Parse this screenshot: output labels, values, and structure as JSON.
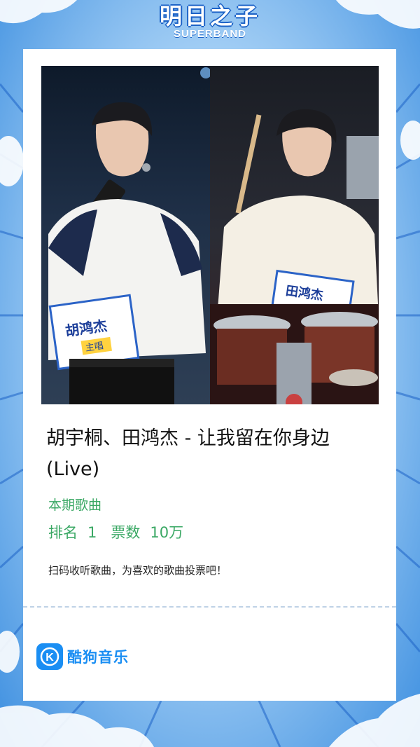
{
  "header": {
    "title_cn": "明日之子",
    "title_en": "SUPERBAND"
  },
  "card": {
    "song_title": "胡宇桐、田鸿杰 - 让我留在你身边 (Live)",
    "subtitle": "本期歌曲",
    "rank_label": "排名",
    "rank_value": "1",
    "votes_label": "票数",
    "votes_value": "10万",
    "hint": "扫码收听歌曲，为喜欢的歌曲投票吧！",
    "photo_left_badge": "主唱",
    "photo_left_name": "胡鸿杰",
    "photo_right_name": "田鸿杰"
  },
  "footer": {
    "brand_name": "酷狗音乐",
    "brand_icon": "K"
  },
  "colors": {
    "accent_green": "#3aa864",
    "brand_blue": "#1a8ef3",
    "background_blue": "#3d8fe0"
  }
}
